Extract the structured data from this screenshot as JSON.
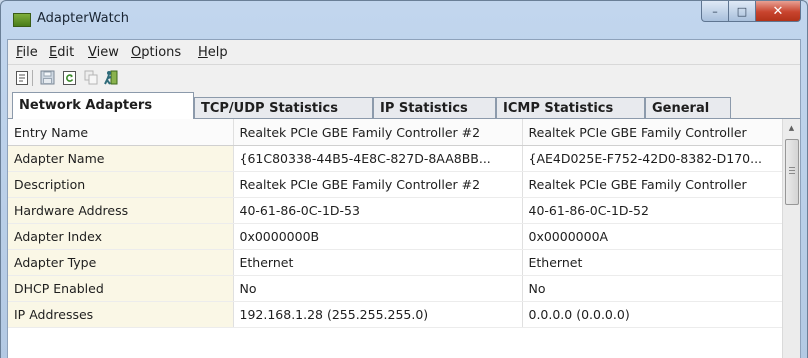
{
  "window": {
    "title": "AdapterWatch",
    "minimize_glyph": "–",
    "maximize_glyph": "□",
    "close_glyph": "✕"
  },
  "menu": [
    {
      "label": "File",
      "accel": "F",
      "rest": "ile"
    },
    {
      "label": "Edit",
      "accel": "E",
      "rest": "dit"
    },
    {
      "label": "View",
      "accel": "V",
      "rest": "iew"
    },
    {
      "label": "Options",
      "accel": "O",
      "rest": "ptions"
    },
    {
      "label": "Help",
      "accel": "H",
      "rest": "elp"
    }
  ],
  "toolbar": {
    "icons": [
      "properties-icon",
      "save-icon",
      "refresh-icon",
      "copy-icon",
      "exit-icon"
    ]
  },
  "tabs": [
    {
      "label": "Network Adapters",
      "active": true
    },
    {
      "label": "TCP/UDP Statistics",
      "active": false
    },
    {
      "label": "IP Statistics",
      "active": false
    },
    {
      "label": "ICMP Statistics",
      "active": false
    },
    {
      "label": "General",
      "active": false
    }
  ],
  "grid": {
    "columns": [
      "Entry Name",
      "Realtek PCIe GBE Family Controller #2",
      "Realtek PCIe GBE Family Controller"
    ],
    "rows": [
      [
        "Adapter Name",
        "{61C80338-44B5-4E8C-827D-8AA8BB...",
        "{AE4D025E-F752-42D0-8382-D170..."
      ],
      [
        "Description",
        "Realtek PCIe GBE Family Controller #2",
        "Realtek PCIe GBE Family Controller"
      ],
      [
        "Hardware Address",
        "40-61-86-0C-1D-53",
        "40-61-86-0C-1D-52"
      ],
      [
        "Adapter Index",
        "0x0000000B",
        "0x0000000A"
      ],
      [
        "Adapter Type",
        "Ethernet",
        "Ethernet"
      ],
      [
        "DHCP Enabled",
        "No",
        "No"
      ],
      [
        "IP Addresses",
        "192.168.1.28 (255.255.255.0)",
        "0.0.0.0 (0.0.0.0)"
      ]
    ]
  },
  "colors": {
    "titlebar": "#b9cee8",
    "close_button": "#c8442e",
    "key_column_bg": "#faf7e6",
    "app_icon": "#5f9428"
  }
}
